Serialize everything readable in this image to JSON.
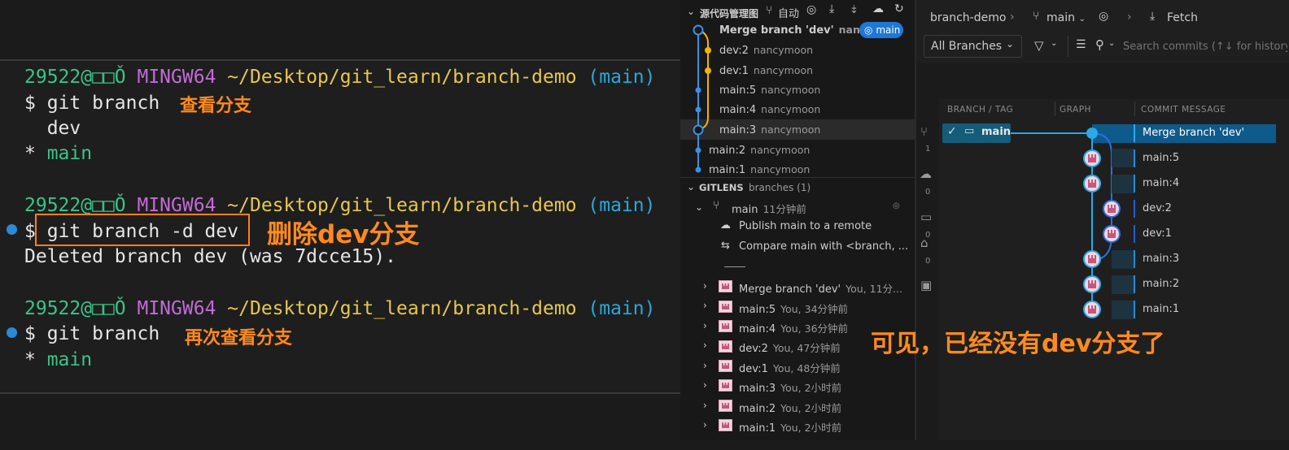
{
  "terminal": {
    "prompt": {
      "user": "29522@□□Ǒ",
      "system": "MINGW64",
      "path": "~/Desktop/git_learn/branch-demo",
      "branch": "(main)"
    },
    "cmd1": "$ git branch",
    "out1a": "  dev",
    "out1b_star": "* ",
    "out1b_name": "main",
    "cmd2": "$ git branch -d dev",
    "out2": "Deleted branch dev (was 7dcce15).",
    "cmd3": "$ git branch",
    "out3_star": "* ",
    "out3_name": "main"
  },
  "annotations": {
    "view_branches": "查看分支",
    "delete_dev": "删除dev分支",
    "view_again": "再次查看分支",
    "conclusion": "可见，已经没有dev分支了"
  },
  "scm": {
    "title": "源代码管理图",
    "auto_label": "自动",
    "commits": [
      {
        "msg": "Merge branch 'dev'",
        "author": "nan...",
        "badge": "main"
      },
      {
        "msg": "dev:2",
        "author": "nancymoon"
      },
      {
        "msg": "dev:1",
        "author": "nancymoon"
      },
      {
        "msg": "main:5",
        "author": "nancymoon"
      },
      {
        "msg": "main:4",
        "author": "nancymoon"
      },
      {
        "msg": "main:3",
        "author": "nancymoon"
      },
      {
        "msg": "main:2",
        "author": "nancymoon"
      },
      {
        "msg": "main:1",
        "author": "nancymoon"
      }
    ]
  },
  "gitlens": {
    "title": "GITLENS",
    "subtitle": "branches (1)",
    "branch_name": "main",
    "branch_time": "11分钟前",
    "publish": "Publish main to a remote",
    "compare": "Compare main with <branch, ...",
    "commits": [
      {
        "msg": "Merge branch 'dev'",
        "meta": "You, 11分..."
      },
      {
        "msg": "main:5",
        "meta": "You, 34分钟前"
      },
      {
        "msg": "main:4",
        "meta": "You, 36分钟前"
      },
      {
        "msg": "dev:2",
        "meta": "You, 47分钟前"
      },
      {
        "msg": "dev:1",
        "meta": "You, 48分钟前"
      },
      {
        "msg": "main:3",
        "meta": "You, 2小时前"
      },
      {
        "msg": "main:2",
        "meta": "You, 2小时前"
      },
      {
        "msg": "main:1",
        "meta": "You, 2小时前"
      }
    ]
  },
  "graph": {
    "repo": "branch-demo",
    "branch": "main",
    "fetch": "Fetch",
    "all_branches": "All Branches",
    "search_placeholder": "Search commits (↑↓ for history)",
    "col_branch": "BRANCH / TAG",
    "col_graph": "GRAPH",
    "col_msg": "COMMIT MESSAGE",
    "head_branch": "main",
    "messages": [
      "Merge branch 'dev'",
      "main:5",
      "main:4",
      "dev:2",
      "dev:1",
      "main:3",
      "main:2",
      "main:1"
    ],
    "side_counts": [
      "1",
      "0",
      "0",
      "0"
    ]
  },
  "colors": {
    "accent": "#2a8ad6",
    "annotation": "#ff8a1f",
    "dev_branch": "#f0b400"
  }
}
